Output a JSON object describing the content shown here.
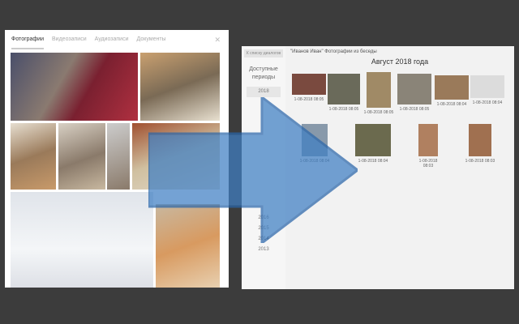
{
  "left_panel": {
    "tabs": [
      "Фотографии",
      "Видеозаписи",
      "Аудиозаписи",
      "Документы"
    ],
    "close_icon": "close-icon"
  },
  "right_panel": {
    "sidebar": {
      "button": "К списку диалогов",
      "heading": "Доступные периоды",
      "years": [
        "2018",
        "",
        "",
        "",
        "",
        "",
        "",
        "",
        "",
        "",
        "",
        "",
        "2016",
        "2015",
        "2014",
        "2013"
      ]
    },
    "breadcrumb": "\"Иванов Иван\" Фотографии из беседы",
    "month_title": "Август 2018 года",
    "photos": [
      {
        "date": "1-08-2018 08:05",
        "color": "#7a4a3f"
      },
      {
        "date": "1-08-2018 08:05",
        "color": "#6a6a5a"
      },
      {
        "date": "1-08-2018 08:05",
        "color": "#a08a66"
      },
      {
        "date": "1-08-2018 08:05",
        "color": "#8a8478"
      },
      {
        "date": "1-08-2018 08:04",
        "color": "#9a7a5a"
      },
      {
        "date": "1-08-2018 08:04",
        "color": "#dcdcdc"
      },
      {
        "date": "1-08-2018 08:04",
        "color": "#8899aa"
      },
      {
        "date": "1-08-2018 08:04",
        "color": "#6b6a4e"
      },
      {
        "date": "1-08-2018 08:03",
        "color": "#b08060"
      },
      {
        "date": "1-08-2018 08:03",
        "color": "#a07050"
      }
    ]
  },
  "colors": {
    "arrow": "#3f7fc4",
    "background": "#3c3c3c"
  }
}
